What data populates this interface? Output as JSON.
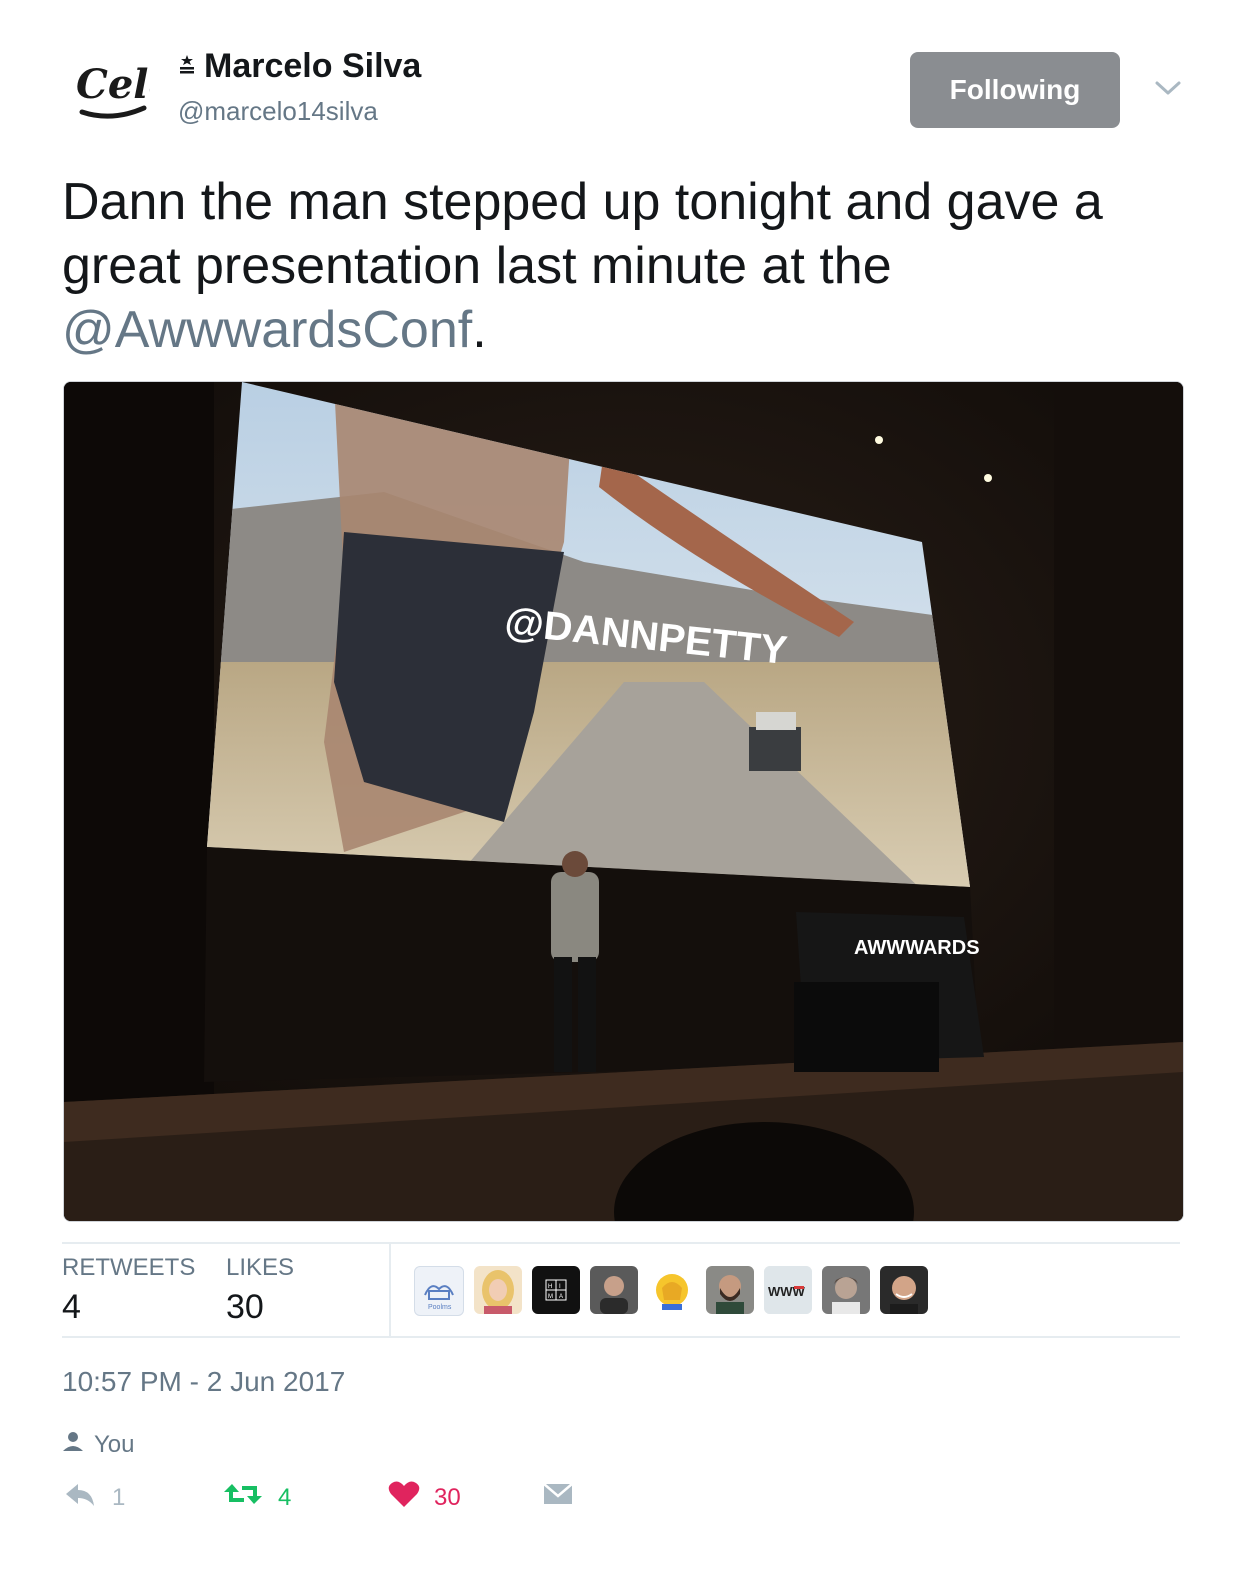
{
  "header": {
    "display_name": "Marcelo Silva",
    "handle": "@marcelo14silva",
    "follow_label": "Following",
    "logo_text": "Celo"
  },
  "tweet": {
    "text_before": "Dann the man stepped up tonight and gave a great presentation last minute at the ",
    "mention": "@AwwwardsConf",
    "text_after": "."
  },
  "photo": {
    "screen_text": "@DANNPETTY",
    "podium_text": "AWWWARDS"
  },
  "stats": {
    "retweets_label": "RETWEETS",
    "retweets_value": "4",
    "likes_label": "LIKES",
    "likes_value": "30"
  },
  "likers": [
    {
      "name": "poolms-avatar",
      "text": "Poolms"
    },
    {
      "name": "blonde-user-avatar",
      "text": ""
    },
    {
      "name": "hima-avatar",
      "text": "H I M A"
    },
    {
      "name": "bald-man-avatar",
      "text": ""
    },
    {
      "name": "facepalm-emoji-avatar",
      "text": ""
    },
    {
      "name": "bearded-man-avatar",
      "text": ""
    },
    {
      "name": "www-avatar",
      "text": "WWW"
    },
    {
      "name": "young-man-avatar",
      "text": ""
    },
    {
      "name": "smiling-man-avatar",
      "text": ""
    }
  ],
  "timestamp": "10:57 PM - 2 Jun 2017",
  "you_label": "You",
  "actions": {
    "reply_count": "1",
    "retweet_count": "4",
    "like_count": "30"
  },
  "colors": {
    "retweet_green": "#17bf63",
    "like_red": "#e0245e",
    "muted": "#657786",
    "following_bg": "#8a8d91"
  }
}
